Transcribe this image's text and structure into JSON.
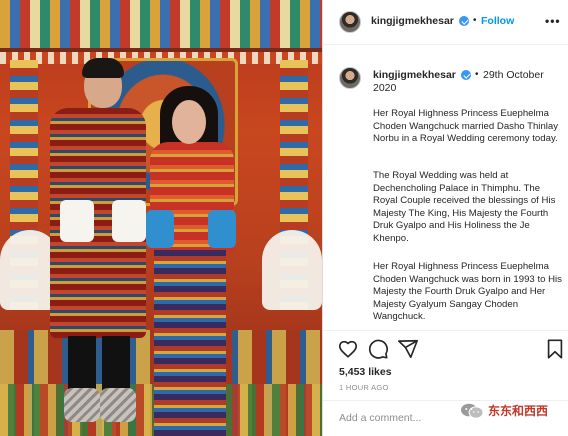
{
  "post": {
    "username": "kingjigmekhesar",
    "follow_label": "Follow",
    "follow_separator": "•",
    "more_label": "•••",
    "date": "29th October 2020",
    "date_separator": "•",
    "caption": [
      "Her Royal Highness Princess Euephelma Choden Wangchuck married Dasho Thinlay Norbu in a Royal Wedding ceremony today.",
      "The Royal Wedding was held at Dechencholing Palace in Thimphu. The Royal Couple received the blessings of His Majesty The King, His Majesty the Fourth Druk Gyalpo and His Holiness the Je Khenpo.",
      "Her Royal Highness Princess Euephelma Choden Wangchuck was born in 1993 to His Majesty the Fourth Druk Gyalpo and Her Majesty Gyalyum Sangay Choden Wangchuck."
    ],
    "likes": "5,453 likes",
    "time_ago": "1 HOUR AGO",
    "comment_placeholder": "Add a comment...",
    "watermark_text": "东东和西西"
  },
  "colors": {
    "link_blue": "#0095f6",
    "verified_blue": "#3897f0",
    "muted_gray": "#8e8e8e",
    "watermark_red": "#c0392b"
  },
  "icons": [
    "verified-badge-icon",
    "heart-icon",
    "comment-icon",
    "share-icon",
    "bookmark-icon",
    "wechat-icon"
  ]
}
